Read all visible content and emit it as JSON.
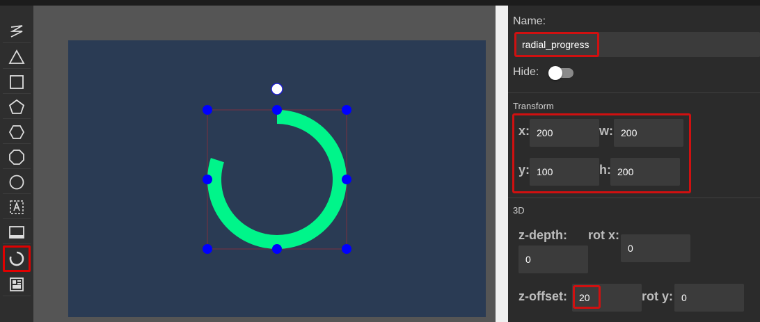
{
  "toolbar": {
    "tools": [
      {
        "icon": "freehand-line-icon"
      },
      {
        "icon": "triangle-icon"
      },
      {
        "icon": "square-icon"
      },
      {
        "icon": "pentagon-icon"
      },
      {
        "icon": "hexagon-icon"
      },
      {
        "icon": "octagon-icon"
      },
      {
        "icon": "circle-icon"
      },
      {
        "icon": "text-box-icon"
      },
      {
        "icon": "panel-icon"
      },
      {
        "icon": "radial-progress-icon",
        "selected": true
      },
      {
        "icon": "dashboard-icon"
      }
    ]
  },
  "canvas": {
    "background": "#2a3b54",
    "shape_color": "#00f58a",
    "handle_color": "#0000ff",
    "progress_ratio": 0.8
  },
  "properties": {
    "name_label": "Name:",
    "name_value": "radial_progress",
    "hide_label": "Hide:",
    "hide_value": false,
    "transform_title": "Transform",
    "x_label": "x:",
    "x_value": "200",
    "w_label": "w:",
    "w_value": "200",
    "y_label": "y:",
    "y_value": "100",
    "h_label": "h:",
    "h_value": "200",
    "threed_title": "3D",
    "zdepth_label": "z-depth:",
    "zdepth_value": "0",
    "rotx_label": "rot x:",
    "rotx_value": "0",
    "zoffset_label": "z-offset:",
    "zoffset_value": "20",
    "roty_label": "rot y:",
    "roty_value": "0"
  }
}
